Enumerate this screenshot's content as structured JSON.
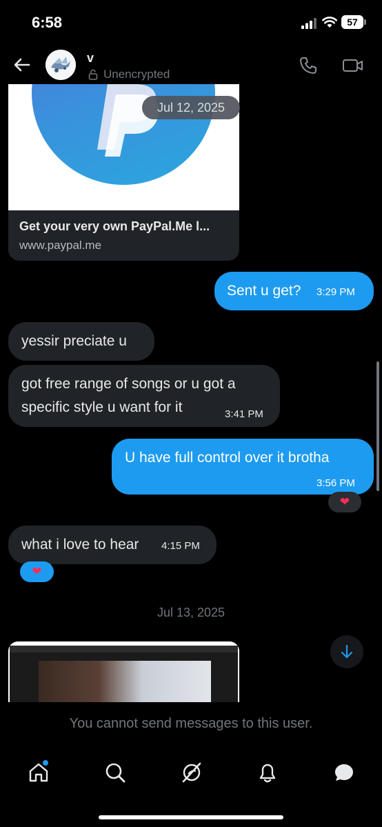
{
  "status_bar": {
    "time": "6:58",
    "battery": "57"
  },
  "header": {
    "contact_name": "v",
    "encryption_label": "Unencrypted"
  },
  "link_preview": {
    "title": "Get your very own PayPal.Me l...",
    "domain": "www.paypal.me",
    "date_overlay": "Jul 12, 2025"
  },
  "messages": [
    {
      "direction": "out",
      "text": "Sent u get?",
      "time": "3:29 PM"
    },
    {
      "direction": "in",
      "text": "yessir preciate u",
      "time": ""
    },
    {
      "direction": "in",
      "lines": [
        "got free range of songs or u got a",
        "specific style u want for it"
      ],
      "time": "3:41 PM"
    },
    {
      "direction": "out",
      "text": "U have full control over it brotha",
      "time": "3:56 PM",
      "reaction": "heart"
    },
    {
      "direction": "in",
      "text": "what i love to hear",
      "time": "4:15 PM",
      "reaction": "heart"
    }
  ],
  "date_separator": "Jul 13, 2025",
  "compose_note": "You cannot send messages to this user.",
  "colors": {
    "accent": "#1d9bf0",
    "incoming_bubble": "#202327",
    "reaction": "#ff2d55"
  },
  "tabbar": {
    "items": [
      "home-icon",
      "search-icon",
      "grok-icon",
      "bell-icon",
      "messages-icon"
    ],
    "home_has_notification": true
  }
}
